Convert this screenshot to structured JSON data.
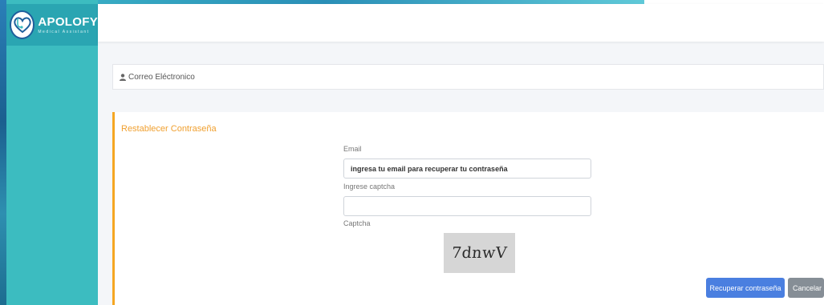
{
  "brand": {
    "name": "APOLOFY",
    "subtitle": "Medical Assistant"
  },
  "header": {
    "section_title": "Correo Eléctronico"
  },
  "form": {
    "title": "Restablecer Contraseña",
    "email_label": "Email",
    "email_placeholder": "ingresa tu email para recuperar tu contraseña",
    "captcha_input_label": "Ingrese captcha",
    "captcha_input_value": "",
    "captcha_label": "Captcha",
    "captcha_code": "7dnwV"
  },
  "buttons": {
    "recover": "Recuperar contraseña",
    "cancel": "Cancelar"
  },
  "colors": {
    "sidebar": "#3cbcc0",
    "accent": "#f5a623",
    "primary": "#4a7fe0",
    "secondary": "#868e96"
  },
  "icons": {
    "logo": "stethoscope-heart-icon",
    "section": "user-icon"
  }
}
